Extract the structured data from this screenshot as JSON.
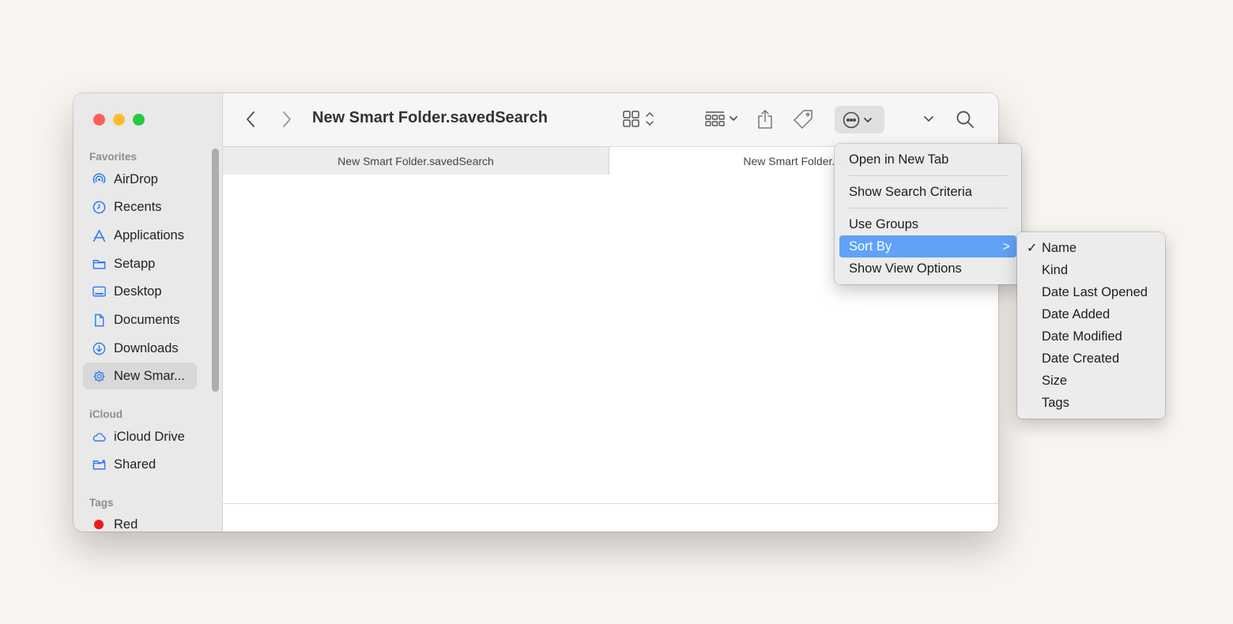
{
  "window": {
    "title": "New Smart Folder.savedSearch"
  },
  "sidebar": {
    "sections": {
      "favorites": "Favorites",
      "icloud": "iCloud",
      "tags": "Tags"
    },
    "favorites": [
      {
        "label": "AirDrop",
        "icon": "airdrop-icon"
      },
      {
        "label": "Recents",
        "icon": "clock-icon"
      },
      {
        "label": "Applications",
        "icon": "applications-icon"
      },
      {
        "label": "Setapp",
        "icon": "folder-icon"
      },
      {
        "label": "Desktop",
        "icon": "desktop-icon"
      },
      {
        "label": "Documents",
        "icon": "document-icon"
      },
      {
        "label": "Downloads",
        "icon": "download-icon"
      },
      {
        "label": "New Smar...",
        "icon": "gear-icon",
        "selected": true
      }
    ],
    "icloud": [
      {
        "label": "iCloud Drive",
        "icon": "cloud-icon"
      },
      {
        "label": "Shared",
        "icon": "shared-folder-icon"
      }
    ],
    "tags": [
      {
        "label": "Red",
        "color": "#ee1a1a"
      }
    ]
  },
  "tabs": [
    {
      "label": "New Smart Folder.savedSearch",
      "active": false
    },
    {
      "label": "New Smart Folder.saved",
      "active": true
    }
  ],
  "menu": {
    "items": {
      "open_new_tab": "Open in New Tab",
      "show_search_criteria": "Show Search Criteria",
      "use_groups": "Use Groups",
      "sort_by": "Sort By",
      "show_view_options": "Show View Options"
    },
    "submenu_arrow": ">"
  },
  "sort_submenu": {
    "checkmark": "✓",
    "selected": "Name",
    "options": [
      "Name",
      "Kind",
      "Date Last Opened",
      "Date Added",
      "Date Modified",
      "Date Created",
      "Size",
      "Tags"
    ]
  },
  "colors": {
    "accent": "#5fa2f8",
    "sidebar_icon": "#2f7bf5",
    "close": "#fe5f57",
    "minimize": "#febc2e",
    "zoom": "#28c840"
  }
}
